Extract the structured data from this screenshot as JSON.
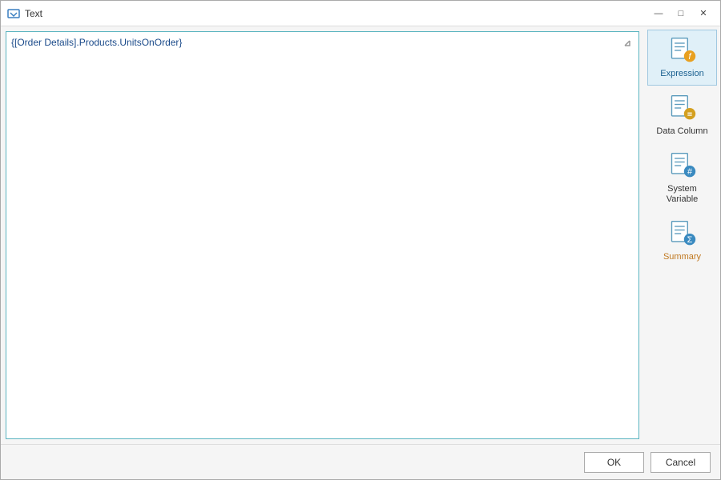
{
  "window": {
    "title": "Text"
  },
  "titlebar": {
    "minimize_label": "—",
    "maximize_label": "□",
    "close_label": "✕"
  },
  "textarea": {
    "value": "{[Order Details].Products.UnitsOnOrder}",
    "placeholder": ""
  },
  "sidebar": {
    "buttons": [
      {
        "id": "expression",
        "label": "Expression",
        "active": true,
        "badge": "f",
        "badge_color": "orange"
      },
      {
        "id": "data-column",
        "label": "Data Column",
        "active": false,
        "badge": "",
        "badge_color": "gold"
      },
      {
        "id": "system-variable",
        "label": "System\nVariable",
        "active": false,
        "badge": "#",
        "badge_color": "blue"
      },
      {
        "id": "summary",
        "label": "Summary",
        "active": false,
        "badge": "Σ",
        "badge_color": "blue"
      }
    ]
  },
  "footer": {
    "ok_label": "OK",
    "cancel_label": "Cancel"
  }
}
